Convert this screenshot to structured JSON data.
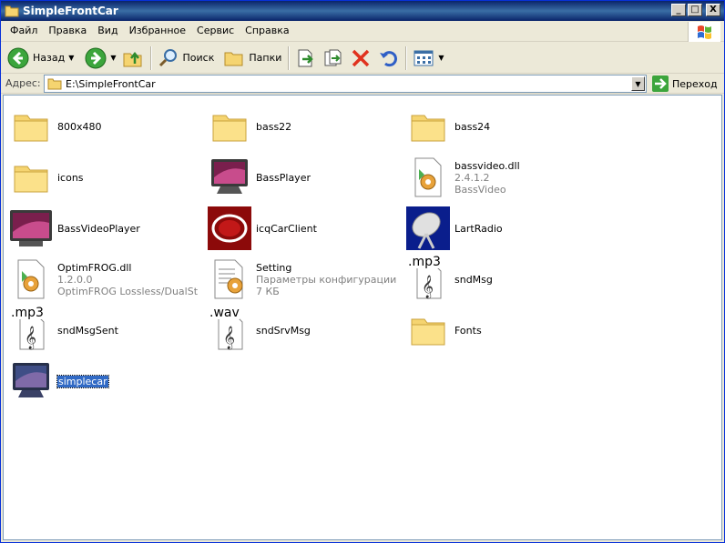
{
  "window": {
    "title": "SimpleFrontCar",
    "buttons": {
      "minimize": "_",
      "maximize": "□",
      "close": "X"
    }
  },
  "menu": {
    "items": [
      "Файл",
      "Правка",
      "Вид",
      "Избранное",
      "Сервис",
      "Справка"
    ]
  },
  "toolbar": {
    "back_label": "Назад",
    "search_label": "Поиск",
    "folders_label": "Папки"
  },
  "address": {
    "label": "Адрес:",
    "path": "E:\\SimpleFrontCar",
    "go_label": "Переход"
  },
  "files": [
    {
      "name": "800x480",
      "icon": "folder-icon"
    },
    {
      "name": "bass22",
      "icon": "folder-icon"
    },
    {
      "name": "bass24",
      "icon": "folder-icon"
    },
    {
      "name": "icons",
      "icon": "folder-icon"
    },
    {
      "name": "BassPlayer",
      "icon": "monitor-app-icon"
    },
    {
      "name": "bassvideo.dll",
      "icon": "dll-gear-icon",
      "line2": "2.4.1.2",
      "line3": "BassVideo"
    },
    {
      "name": "BassVideoPlayer",
      "icon": "video-player-icon"
    },
    {
      "name": "icqCarClient",
      "icon": "icq-client-icon"
    },
    {
      "name": "LartRadio",
      "icon": "radio-dish-icon"
    },
    {
      "name": "OptimFROG.dll",
      "icon": "dll-gear-icon",
      "line2": "1.2.0.0",
      "line3": "OptimFROG Lossless/DualStre..."
    },
    {
      "name": "Setting",
      "icon": "settings-file-icon",
      "line2": "Параметры конфигурации",
      "line3": "7 КБ"
    },
    {
      "name": "sndMsg",
      "icon": "audio-file-icon",
      "ext": ".mp3"
    },
    {
      "name": "sndMsgSent",
      "icon": "audio-file-icon",
      "ext": ".mp3"
    },
    {
      "name": "sndSrvMsg",
      "icon": "audio-file-icon",
      "ext": ".wav"
    },
    {
      "name": "Fonts",
      "icon": "folder-icon"
    },
    {
      "name": "simplecar",
      "icon": "monitor-app-icon",
      "selected": true
    }
  ]
}
